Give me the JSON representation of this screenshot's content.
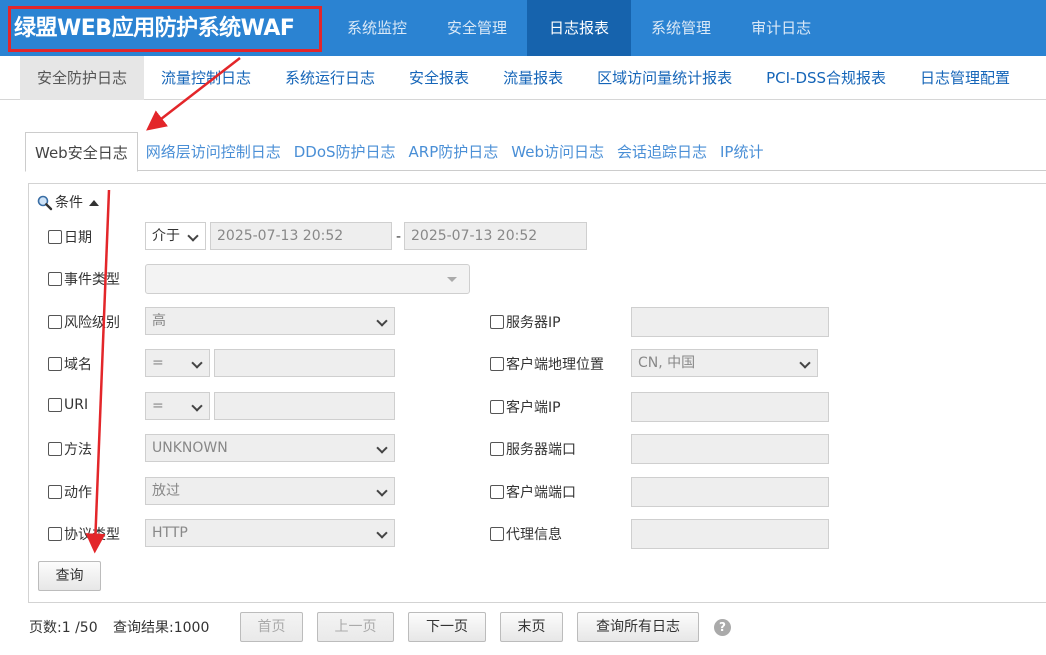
{
  "header": {
    "brand": "绿盟WEB应用防护系统WAF",
    "nav": [
      "系统监控",
      "安全管理",
      "日志报表",
      "系统管理",
      "审计日志"
    ],
    "active_nav": "日志报表"
  },
  "subnav": {
    "items": [
      "安全防护日志",
      "流量控制日志",
      "系统运行日志",
      "安全报表",
      "流量报表",
      "区域访问量统计报表",
      "PCI-DSS合规报表",
      "日志管理配置"
    ],
    "active": "安全防护日志"
  },
  "tabs": {
    "items": [
      "Web安全日志",
      "网络层访问控制日志",
      "DDoS防护日志",
      "ARP防护日志",
      "Web访问日志",
      "会话追踪日志",
      "IP统计"
    ],
    "active": "Web安全日志"
  },
  "conditions": {
    "title": "条件",
    "date": {
      "label": "日期",
      "operator": "介于",
      "start": "2025-07-13 20:52",
      "separator": "-",
      "end": "2025-07-13 20:52"
    },
    "event_type": {
      "label": "事件类型",
      "value": ""
    },
    "risk_level": {
      "label": "风险级别",
      "value": "高"
    },
    "domain": {
      "label": "域名",
      "operator": "=",
      "value": ""
    },
    "uri": {
      "label": "URI",
      "operator": "=",
      "value": ""
    },
    "method": {
      "label": "方法",
      "value": "UNKNOWN"
    },
    "action": {
      "label": "动作",
      "value": "放过"
    },
    "protocol": {
      "label": "协议类型",
      "value": "HTTP"
    },
    "server_ip": {
      "label": "服务器IP",
      "value": ""
    },
    "client_geo": {
      "label": "客户端地理位置",
      "value": "CN, 中国"
    },
    "client_ip": {
      "label": "客户端IP",
      "value": ""
    },
    "server_port": {
      "label": "服务器端口",
      "value": ""
    },
    "client_port": {
      "label": "客户端端口",
      "value": ""
    },
    "proxy_info": {
      "label": "代理信息",
      "value": ""
    },
    "query_button": "查询"
  },
  "pager": {
    "pages": "页数:1 /50",
    "results": "查询结果:1000",
    "first": "首页",
    "prev": "上一页",
    "next": "下一页",
    "last": "末页",
    "query_all": "查询所有日志",
    "help": "?"
  },
  "colors": {
    "topbar": "#2b83d2",
    "topbar_active": "#1663ad",
    "link": "#1565b8",
    "annotation": "#e3262a"
  }
}
